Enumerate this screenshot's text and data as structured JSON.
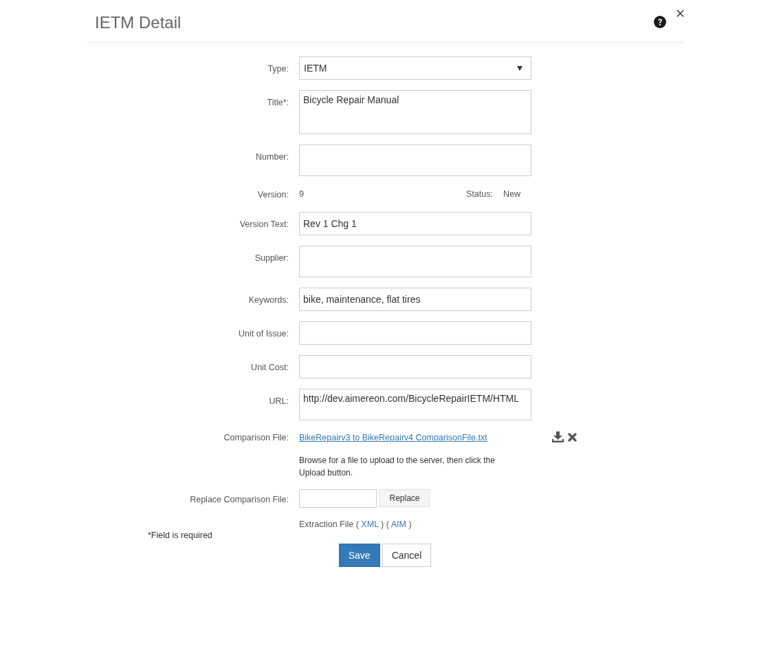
{
  "dialog": {
    "title": "IETM Detail"
  },
  "form": {
    "rows": [
      {
        "kind": "select",
        "label": "Type:",
        "value": "IETM"
      },
      {
        "kind": "tallarea",
        "label": "Title*:",
        "value": "Bicycle Repair Manual"
      },
      {
        "kind": "textarea",
        "label": "Number:"
      },
      {
        "kind": "readout",
        "label": "Version:",
        "value": "9",
        "status_label": "Status:",
        "status_value": "New"
      },
      {
        "kind": "input",
        "label": "Version Text:",
        "value": "Rev 1 Chg 1"
      },
      {
        "kind": "textarea",
        "label": "Supplier:"
      },
      {
        "kind": "input",
        "label": "Keywords:",
        "value": "bike, maintenance, flat tires"
      },
      {
        "kind": "input",
        "label": "Unit of Issue:"
      },
      {
        "kind": "input",
        "label": "Unit Cost:"
      },
      {
        "kind": "textarea",
        "label": "URL:",
        "value": "http://dev.aimereon.com/BicycleRepairIETM/HTML"
      },
      {
        "kind": "file",
        "label": "Comparison File:",
        "link": "BikeRepairv3 to BikeRepairv4 ComparisonFile.txt"
      },
      {
        "kind": "note",
        "text": "Browse for a file to upload to the server, then click the Upload button."
      },
      {
        "kind": "upload",
        "label": "Replace Comparison File:",
        "button": "Replace"
      },
      {
        "kind": "links",
        "parts": [
          {
            "kind": "text",
            "text": "Extraction File ("
          },
          {
            "kind": "link",
            "text": "XML"
          },
          {
            "kind": "text",
            "text": ") ("
          },
          {
            "kind": "link",
            "text": "AIM"
          },
          {
            "kind": "text",
            "text": ")"
          }
        ]
      }
    ]
  },
  "required_note": "*Field is required",
  "buttons": [
    {
      "kind": "primary",
      "label": "Save"
    },
    {
      "kind": "default",
      "label": "Cancel"
    }
  ]
}
